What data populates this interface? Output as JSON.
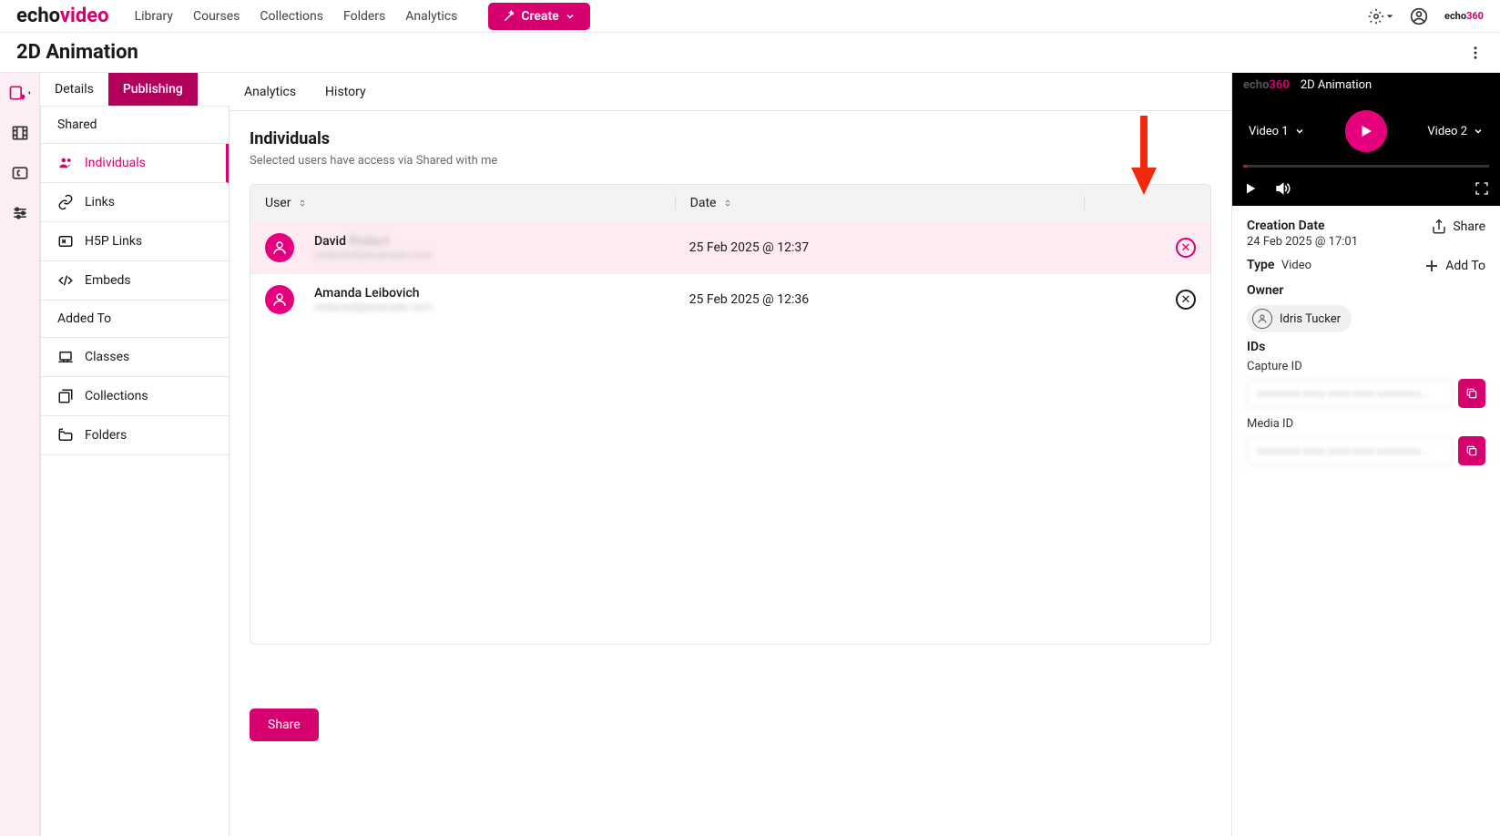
{
  "brand": {
    "part1": "echo",
    "part2": "video"
  },
  "topnav": {
    "links": [
      "Library",
      "Courses",
      "Collections",
      "Folders",
      "Analytics"
    ],
    "create": "Create"
  },
  "smallBrand": {
    "part1": "echo",
    "part2": "360"
  },
  "page": {
    "title": "2D Animation"
  },
  "tabs": [
    "Details",
    "Publishing",
    "Analytics",
    "History"
  ],
  "activeTab": "Publishing",
  "sidebar": {
    "section1": "Shared",
    "individuals": "Individuals",
    "links": "Links",
    "h5p": "H5P Links",
    "embeds": "Embeds",
    "section2": "Added To",
    "classes": "Classes",
    "collections": "Collections",
    "folders": "Folders"
  },
  "main": {
    "title": "Individuals",
    "subtitle": "Selected users have access via Shared with me",
    "columns": {
      "user": "User",
      "date": "Date"
    },
    "rows": [
      {
        "name": "David",
        "email": "redacted@example.com",
        "name_blur": "Redact",
        "date": "25 Feb 2025 @ 12:37",
        "highlight": true
      },
      {
        "name": "Amanda Leibovich",
        "email": "redacted@example.com",
        "name_blur": "",
        "date": "25 Feb 2025 @ 12:36",
        "highlight": false
      }
    ],
    "shareBtn": "Share"
  },
  "player": {
    "title": "2D Animation",
    "video1": "Video 1",
    "video2": "Video 2"
  },
  "meta": {
    "creationLabel": "Creation Date",
    "creationValue": "24 Feb 2025 @ 17:01",
    "shareAction": "Share",
    "typeLabel": "Type",
    "typeValue": "Video",
    "addToAction": "Add To",
    "ownerLabel": "Owner",
    "ownerName": "Idris Tucker",
    "idsLabel": "IDs",
    "captureIdLabel": "Capture ID",
    "captureIdValue": "xxxxxxxx-xxxx-xxxx-xxxx-xxxxxxxx…",
    "mediaIdLabel": "Media ID",
    "mediaIdValue": "xxxxxxxx-xxxx-xxxx-xxxx-xxxxxxxx…"
  }
}
